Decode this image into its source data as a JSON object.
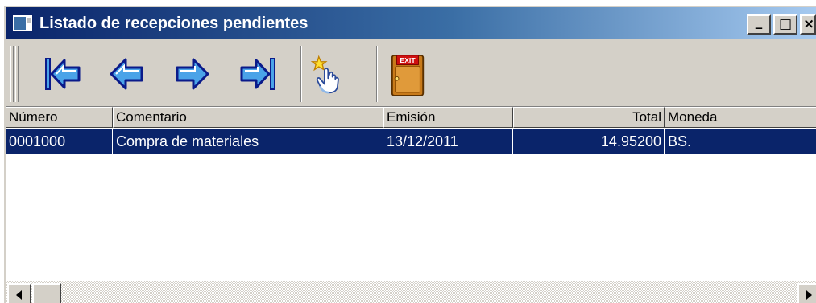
{
  "window": {
    "title": "Listado de recepciones pendientes",
    "controls": {
      "minimize": "_",
      "maximize": "□",
      "close": "×"
    }
  },
  "toolbar": {
    "buttons": [
      {
        "name": "first",
        "icon": "first-record-arrow-icon"
      },
      {
        "name": "previous",
        "icon": "previous-record-arrow-icon"
      },
      {
        "name": "next",
        "icon": "next-record-arrow-icon"
      },
      {
        "name": "last",
        "icon": "last-record-arrow-icon"
      },
      {
        "name": "select",
        "icon": "pointing-hand-icon"
      },
      {
        "name": "exit",
        "icon": "exit-door-icon",
        "label": "EXIT"
      }
    ],
    "colors": {
      "arrow_fill": "#4aa3e8",
      "arrow_stroke": "#0a1a8a",
      "door": "#c87a1a",
      "exit_sign": "#d01010"
    }
  },
  "grid": {
    "columns": [
      "Número",
      "Comentario",
      "Emisión",
      "Total",
      "Moneda"
    ],
    "rows": [
      {
        "numero": "0001000",
        "comentario": "Compra de materiales",
        "emision": "13/12/2011",
        "total": "14.95200",
        "moneda": "BS."
      }
    ],
    "selection_color": "#0a246a"
  }
}
